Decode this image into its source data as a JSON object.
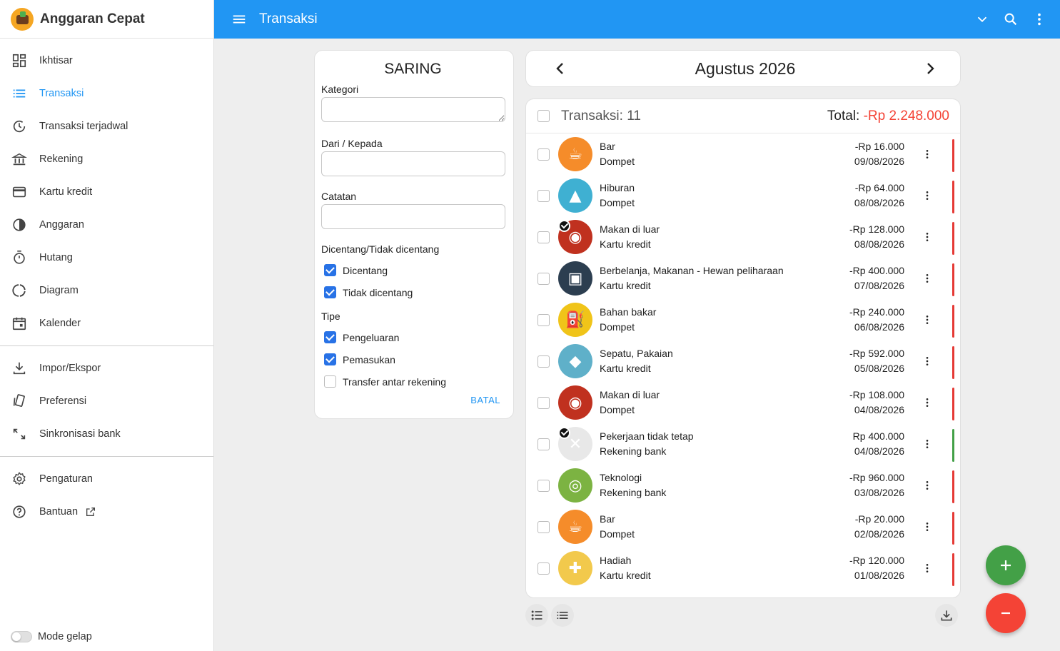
{
  "app": {
    "name": "Anggaran Cepat"
  },
  "header": {
    "title": "Transaksi"
  },
  "sidebar": {
    "groups": [
      [
        {
          "label": "Ikhtisar",
          "icon": "dashboard-icon"
        },
        {
          "label": "Transaksi",
          "icon": "list-icon",
          "active": true
        },
        {
          "label": "Transaksi terjadwal",
          "icon": "scheduled-icon"
        },
        {
          "label": "Rekening",
          "icon": "bank-icon"
        },
        {
          "label": "Kartu kredit",
          "icon": "credit-card-icon"
        },
        {
          "label": "Anggaran",
          "icon": "budget-icon"
        },
        {
          "label": "Hutang",
          "icon": "timer-icon"
        },
        {
          "label": "Diagram",
          "icon": "chart-icon"
        },
        {
          "label": "Kalender",
          "icon": "calendar-icon"
        }
      ],
      [
        {
          "label": "Impor/Ekspor",
          "icon": "download-icon"
        },
        {
          "label": "Preferensi",
          "icon": "preferences-icon"
        },
        {
          "label": "Sinkronisasi bank",
          "icon": "sync-icon"
        }
      ],
      [
        {
          "label": "Pengaturan",
          "icon": "settings-icon"
        },
        {
          "label": "Bantuan",
          "icon": "help-icon"
        }
      ]
    ],
    "dark_mode_label": "Mode gelap"
  },
  "filter": {
    "title": "SARING",
    "category_label": "Kategori",
    "from_to_label": "Dari / Kepada",
    "notes_label": "Catatan",
    "checked_group_label": "Dicentang/Tidak dicentang",
    "checked_options": [
      {
        "label": "Dicentang",
        "checked": true
      },
      {
        "label": "Tidak dicentang",
        "checked": true
      }
    ],
    "type_group_label": "Tipe",
    "type_options": [
      {
        "label": "Pengeluaran",
        "checked": true
      },
      {
        "label": "Pemasukan",
        "checked": true
      },
      {
        "label": "Transfer antar rekening",
        "checked": false
      }
    ],
    "cancel_label": "BATAL"
  },
  "month_nav": {
    "title": "Agustus 2026"
  },
  "list": {
    "count_label": "Transaksi: 11",
    "total_label": "Total:",
    "total_value": "-Rp 2.248.000",
    "colors": {
      "expense": "#e53935",
      "income": "#43a047"
    },
    "items": [
      {
        "category": "Bar",
        "account": "Dompet",
        "amount": "-Rp 16.000",
        "date": "09/08/2026",
        "type": "expense",
        "icon": "coffee-icon",
        "bg": "#f58c2a",
        "glyph": "☕",
        "checked": false
      },
      {
        "category": "Hiburan",
        "account": "Dompet",
        "amount": "-Rp 64.000",
        "date": "08/08/2026",
        "type": "expense",
        "icon": "party-hat-icon",
        "bg": "#3fb0d2",
        "glyph": "▲",
        "checked": false
      },
      {
        "category": "Makan di luar",
        "account": "Kartu kredit",
        "amount": "-Rp 128.000",
        "date": "08/08/2026",
        "type": "expense",
        "icon": "plate-icon",
        "bg": "#c0311f",
        "glyph": "◉",
        "checked": true
      },
      {
        "category": "Berbelanja, Makanan - Hewan peliharaan",
        "account": "Kartu kredit",
        "amount": "-Rp 400.000",
        "date": "07/08/2026",
        "type": "expense",
        "icon": "shopping-pet-icon",
        "bg": "#2c3e50",
        "glyph": "▣",
        "checked": false
      },
      {
        "category": "Bahan bakar",
        "account": "Dompet",
        "amount": "-Rp 240.000",
        "date": "06/08/2026",
        "type": "expense",
        "icon": "fuel-icon",
        "bg": "#f0c419",
        "glyph": "⛽",
        "checked": false
      },
      {
        "category": "Sepatu, Pakaian",
        "account": "Kartu kredit",
        "amount": "-Rp 592.000",
        "date": "05/08/2026",
        "type": "expense",
        "icon": "shoe-clothes-icon",
        "bg": "#5fb0c9",
        "glyph": "◆",
        "checked": false
      },
      {
        "category": "Makan di luar",
        "account": "Dompet",
        "amount": "-Rp 108.000",
        "date": "04/08/2026",
        "type": "expense",
        "icon": "plate-icon",
        "bg": "#c0311f",
        "glyph": "◉",
        "checked": false
      },
      {
        "category": "Pekerjaan tidak tetap",
        "account": "Rekening bank",
        "amount": "Rp 400.000",
        "date": "04/08/2026",
        "type": "income",
        "icon": "tools-icon",
        "bg": "#e8e8e8",
        "glyph": "✕",
        "checked": true
      },
      {
        "category": "Teknologi",
        "account": "Rekening bank",
        "amount": "-Rp 960.000",
        "date": "03/08/2026",
        "type": "expense",
        "icon": "hard-drive-icon",
        "bg": "#7cb342",
        "glyph": "◎",
        "checked": false
      },
      {
        "category": "Bar",
        "account": "Dompet",
        "amount": "-Rp 20.000",
        "date": "02/08/2026",
        "type": "expense",
        "icon": "coffee-icon",
        "bg": "#f58c2a",
        "glyph": "☕",
        "checked": false
      },
      {
        "category": "Hadiah",
        "account": "Kartu kredit",
        "amount": "-Rp 120.000",
        "date": "01/08/2026",
        "type": "expense",
        "icon": "gift-icon",
        "bg": "#f2c94c",
        "glyph": "✚",
        "checked": false
      }
    ]
  },
  "fab": {
    "add_color": "#43a047",
    "remove_color": "#f44336"
  }
}
